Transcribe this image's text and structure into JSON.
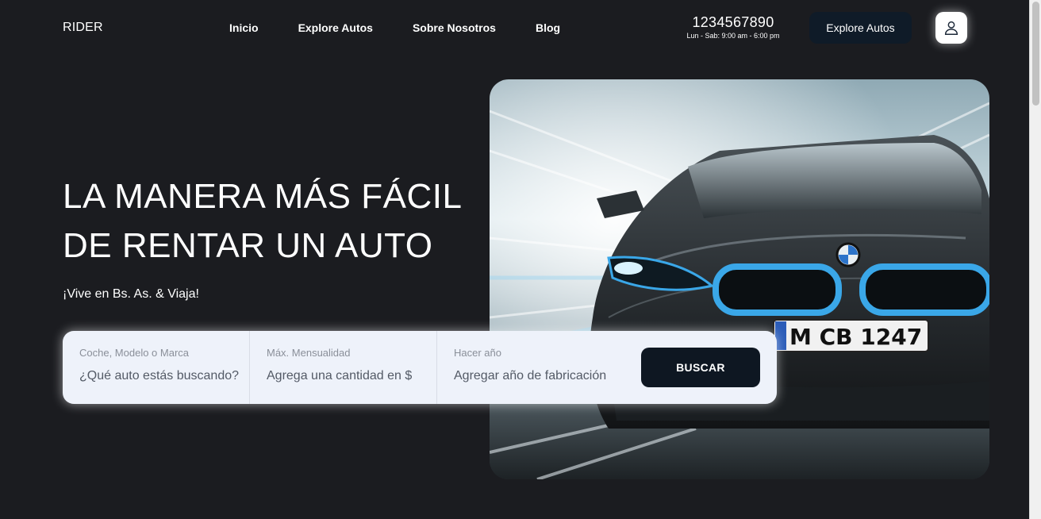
{
  "header": {
    "brand": "RIDER",
    "nav": [
      "Inicio",
      "Explore Autos",
      "Sobre Nosotros",
      "Blog"
    ],
    "phone_number": "1234567890",
    "phone_hours": "Lun - Sab: 9:00 am - 6:00 pm",
    "cta_label": "Explore Autos",
    "user_icon": "user-icon"
  },
  "hero": {
    "title_line1": "LA MANERA MÁS FÁCIL",
    "title_line2": "DE RENTAR UN AUTO",
    "subtitle": "¡Vive en Bs. As. & Viaja!",
    "image_plate": "M CB 1247"
  },
  "search": {
    "fields": [
      {
        "label": "Coche, Modelo o Marca",
        "placeholder": "¿Qué auto estás buscando?"
      },
      {
        "label": "Máx. Mensualidad",
        "placeholder": "Agrega una cantidad en $"
      },
      {
        "label": "Hacer año",
        "placeholder": "Agregar año de fabricación"
      }
    ],
    "button_label": "BUSCAR"
  },
  "colors": {
    "background": "#1b1c20",
    "button_dark": "#0e1722",
    "search_bg": "#eef2fa",
    "headlight_blue": "#3aa7e8"
  }
}
